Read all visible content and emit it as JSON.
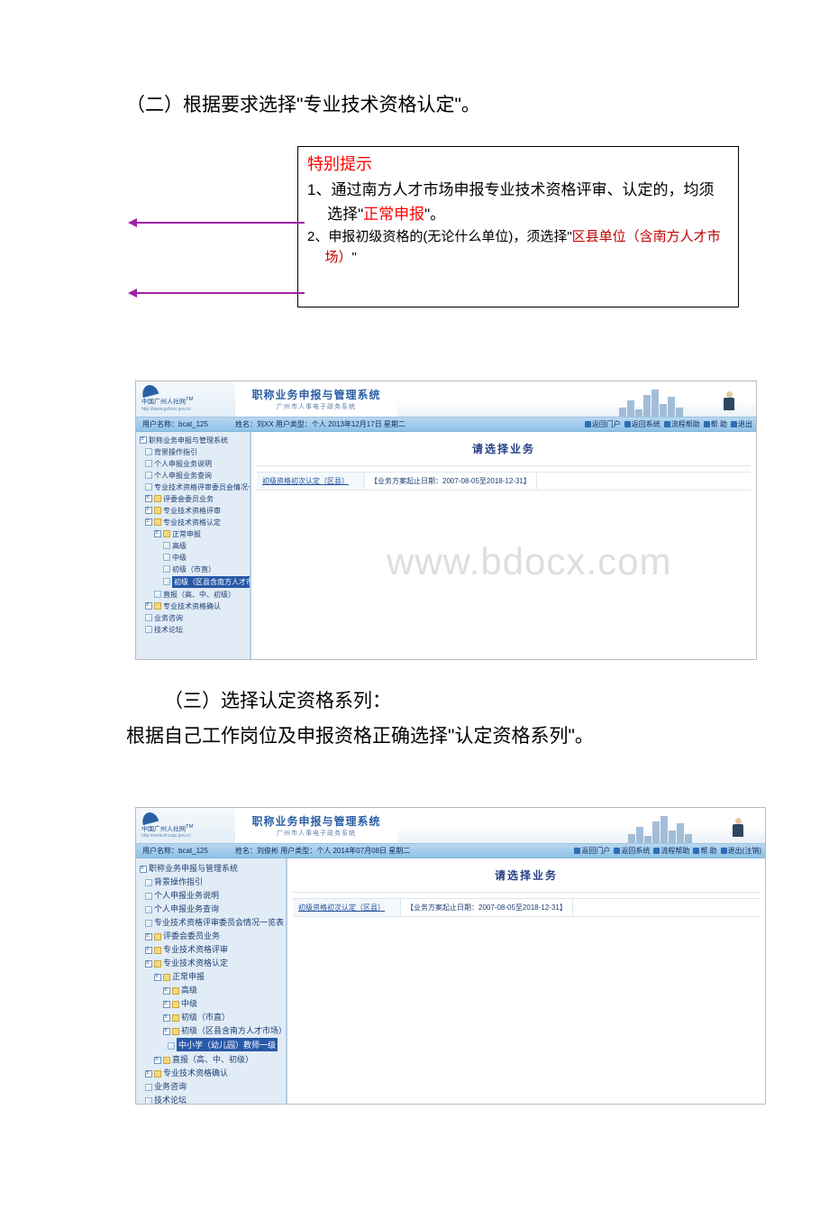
{
  "section2": {
    "title": "（二）根据要求选择\"专业技术资格认定\"。",
    "callout": {
      "heading": "特别提示",
      "item1_prefix": "1、通过南方人才市场申报专业技术资格评审、认定的，均须选择\"",
      "item1_em": "正常申报",
      "item1_suffix": "\"。",
      "item2_prefix": "2、申报初级资格的(无论什么单位)，须选择\"",
      "item2_em": "区县单位（含南方人才市场）",
      "item2_suffix": "\""
    }
  },
  "shot1": {
    "logo_name": "中国广州人社网",
    "logo_sup": "TM",
    "logo_url": "http://www.gzhrss.gov.cn",
    "title_main": "职称业务申报与管理系统",
    "title_sub": "广州市人事电子政务系统",
    "infobar": {
      "user_label": "用户名称：bcat_125",
      "mid": "姓名：刘XX    用户类型：个人   2013年12月17日 星期二",
      "btns": [
        "返回门户",
        "返回系统",
        "流程帮助",
        "帮 助",
        "退出"
      ]
    },
    "sidebar_nodes": [
      "职称业务申报与管理系统",
      "背景操作指引",
      "个人申报业务说明",
      "个人申报业务查询",
      "专业技术资格评审委员会情况一览表",
      "评委会委员业务",
      "专业技术资格评审",
      "专业技术资格认定",
      "正常申报",
      "高级",
      "中级",
      "初级（市直）",
      "初级（区县含南方人才市场）",
      "直报（高、中、初级）",
      "专业技术资格确认",
      "业务咨询",
      "技术论坛"
    ],
    "content_title": "请选择业务",
    "row_cell1": "初级资格初次认定（区县）",
    "row_cell2": "【业务方案起止日期：2007-08-05至2018-12-31】",
    "watermark": "www.bdocx.com"
  },
  "section3": {
    "title": "（三）选择认定资格系列：",
    "body": "根据自己工作岗位及申报资格正确选择\"认定资格系列\"。"
  },
  "shot2": {
    "logo_name": "中国广州人社网",
    "logo_sup": "TM",
    "logo_url": "http://www.hrssgz.gov.cn",
    "title_main": "职称业务申报与管理系统",
    "title_sub": "广州市人事电子政务系统",
    "infobar": {
      "user_label": "用户名称：bcat_125",
      "mid": "姓名：刘俊彬    用户类型：个人   2014年07月08日 星期二",
      "btns": [
        "返回门户",
        "返回系统",
        "流程帮助",
        "帮 助",
        "退出(注销)"
      ]
    },
    "sidebar_nodes": [
      "职称业务申报与管理系统",
      "背景操作指引",
      "个人申报业务说明",
      "个人申报业务查询",
      "专业技术资格评审委员会情况一览表",
      "评委会委员业务",
      "专业技术资格评审",
      "专业技术资格认定",
      "正常申报",
      "高级",
      "中级",
      "初级（市直）",
      "初级（区县含南方人才市场）",
      "中小学（幼儿园）教师一级",
      "直报（高、中、初级）",
      "专业技术资格确认",
      "业务咨询",
      "技术论坛"
    ],
    "content_title": "请选择业务",
    "row_cell1": "初级资格初次认定（区县）",
    "row_cell2": "【业务方案起止日期：2007-08-05至2018-12-31】"
  }
}
